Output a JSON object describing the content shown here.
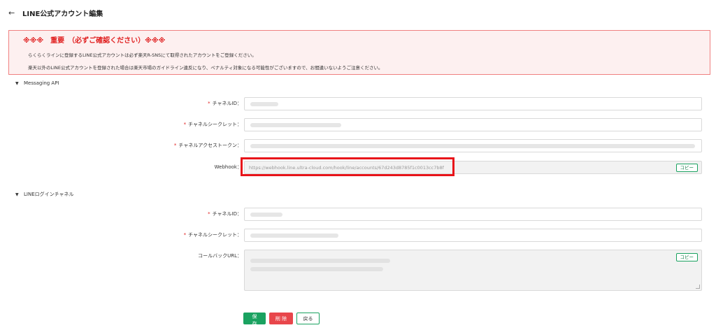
{
  "header": {
    "back_icon": "←",
    "title": "LINE公式アカウント編集"
  },
  "alert": {
    "title": "※※※　重要　（必ずご確認ください）※※※",
    "line1": "らくらくラインに登録するLINE公式アカウントは必ず楽天R-SNSにて取得されたアカウントをご登録ください。",
    "line2": "楽天以外のLINE公式アカウントを登録された場合は楽天市場のガイドライン違反になり、ペナルティ対象になる可能性がございますので、お間違いないようご注意ください。"
  },
  "messaging_api": {
    "section_label": "Messaging API",
    "channel_id_label": "チャネルID：",
    "channel_secret_label": "チャネルシークレット：",
    "access_token_label": "チャネルアクセストークン：",
    "webhook_label": "Webhook：",
    "webhook_value": "https://webhook.line.ultra-cloud.com/hook/line/accounts/67d243d8785f1c0013cc7b8f",
    "copy_label": "コピー"
  },
  "line_login": {
    "section_label": "LINEログインチャネル",
    "channel_id_label": "チャネルID：",
    "channel_secret_label": "チャネルシークレット：",
    "callback_label": "コールバックURL：",
    "copy_label": "コピー"
  },
  "actions": {
    "save": "保 存",
    "delete": "削 除",
    "back": "戻る"
  },
  "colors": {
    "accent_green": "#1aa260",
    "danger_red": "#e8464b",
    "alert_red": "#e02020"
  },
  "required_mark": "*"
}
